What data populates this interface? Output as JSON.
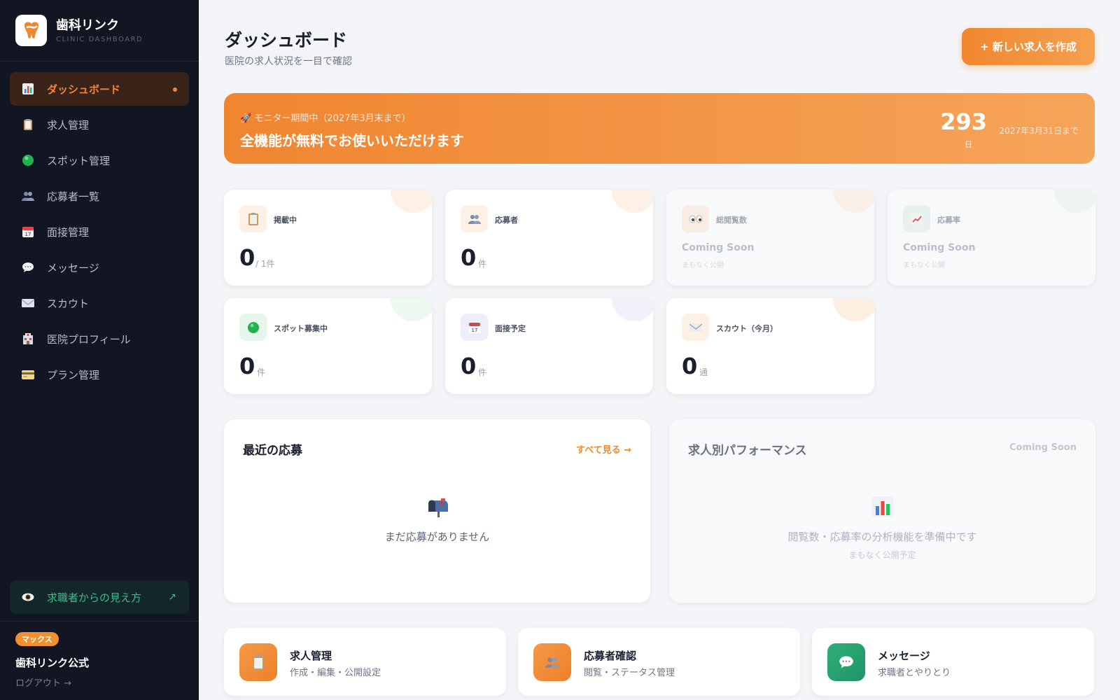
{
  "brand": {
    "title": "歯科リンク",
    "subtitle": "CLINIC DASHBOARD"
  },
  "sidebar": {
    "items": [
      {
        "label": "ダッシュボード",
        "icon": "bar-chart-icon"
      },
      {
        "label": "求人管理",
        "icon": "clipboard-icon"
      },
      {
        "label": "スポット管理",
        "icon": "green-circle-icon"
      },
      {
        "label": "応募者一覧",
        "icon": "people-icon"
      },
      {
        "label": "面接管理",
        "icon": "calendar-icon"
      },
      {
        "label": "メッセージ",
        "icon": "speech-bubble-icon"
      },
      {
        "label": "スカウト",
        "icon": "envelope-icon"
      },
      {
        "label": "医院プロフィール",
        "icon": "hospital-icon"
      },
      {
        "label": "プラン管理",
        "icon": "credit-card-icon"
      }
    ],
    "viewer_link": {
      "label": "求職者からの見え方",
      "arrow": "↗"
    },
    "plan_badge": "マックス",
    "account_name": "歯科リンク公式",
    "logout": "ログアウト →"
  },
  "header": {
    "title": "ダッシュボード",
    "subtitle": "医院の求人状況を一目で確認",
    "create_button": "+ 新しい求人を作成"
  },
  "banner": {
    "tag": "🚀 モニター期間中（2027年3月末まで）",
    "message": "全機能が無料でお使いいただけます",
    "days": "293",
    "days_unit": "日",
    "until": "2027年3月31日まで"
  },
  "stats": [
    {
      "label": "掲載中",
      "value": "0",
      "unit": "/ 1件"
    },
    {
      "label": "応募者",
      "value": "0",
      "unit": "件"
    },
    {
      "label": "総閲覧数",
      "soon": "Coming Soon",
      "soon_sub": "まもなく公開"
    },
    {
      "label": "応募率",
      "soon": "Coming Soon",
      "soon_sub": "まもなく公開"
    },
    {
      "label": "スポット募集中",
      "value": "0",
      "unit": "件"
    },
    {
      "label": "面接予定",
      "value": "0",
      "unit": "件"
    },
    {
      "label": "スカウト（今月）",
      "value": "0",
      "unit": "通"
    }
  ],
  "recent": {
    "title": "最近の応募",
    "link": "すべて見る →",
    "empty": "まだ応募がありません"
  },
  "performance": {
    "title": "求人別パフォーマンス",
    "badge": "Coming Soon",
    "empty": "閲覧数・応募率の分析機能を準備中です",
    "empty_sub": "まもなく公開予定"
  },
  "quick": [
    {
      "title": "求人管理",
      "sub": "作成・編集・公開設定"
    },
    {
      "title": "応募者確認",
      "sub": "閲覧・ステータス管理"
    },
    {
      "title": "メッセージ",
      "sub": "求職者とやりとり"
    }
  ],
  "colors": {
    "accent": "#f0862e",
    "sidebar_bg": "#121522",
    "success": "#3dbd8a"
  }
}
